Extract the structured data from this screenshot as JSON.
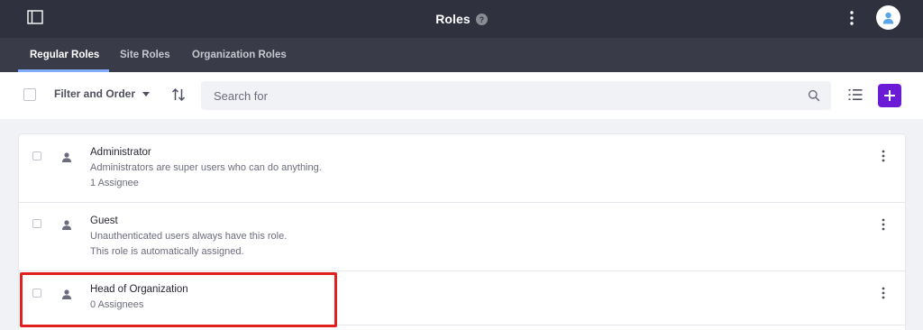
{
  "app": {
    "title": "Roles"
  },
  "tabs": [
    {
      "label": "Regular Roles",
      "active": true
    },
    {
      "label": "Site Roles",
      "active": false
    },
    {
      "label": "Organization Roles",
      "active": false
    }
  ],
  "toolbar": {
    "filter_label": "Filter and Order",
    "search_placeholder": "Search for"
  },
  "roles": [
    {
      "name": "Administrator",
      "description": "Administrators are super users who can do anything.",
      "detail": "1 Assignee"
    },
    {
      "name": "Guest",
      "description": "Unauthenticated users always have this role.",
      "detail": "This role is automatically assigned."
    },
    {
      "name": "Head of Organization",
      "description": "0 Assignees",
      "detail": ""
    }
  ],
  "colors": {
    "topbar": "#30313f",
    "tabsbar": "#3a3b49",
    "accent": "#6b1bd6",
    "tab_underline": "#80acff",
    "highlight": "#e01f1f"
  },
  "icons": {
    "sidebar_toggle": "sidebar-toggle-icon",
    "help": "help-icon",
    "menu": "kebab-icon",
    "user": "user-icon",
    "sort": "sort-icon",
    "search": "search-icon",
    "list_view": "list-view-icon",
    "add": "plus-icon"
  }
}
